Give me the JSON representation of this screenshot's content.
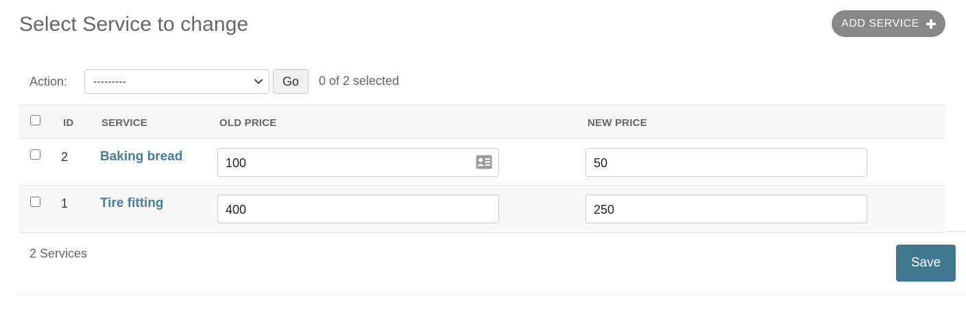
{
  "page": {
    "title": "Select Service to change"
  },
  "header": {
    "add_label": "ADD SERVICE"
  },
  "actions": {
    "label": "Action:",
    "selected_option": "---------",
    "go_label": "Go",
    "selection_text": "0 of 2 selected"
  },
  "table": {
    "columns": [
      "ID",
      "SERVICE",
      "OLD PRICE",
      "NEW PRICE"
    ],
    "rows": [
      {
        "id": "2",
        "service": "Baking bread",
        "old_price": "100",
        "new_price": "50",
        "selected": false
      },
      {
        "id": "1",
        "service": "Tire fitting",
        "old_price": "400",
        "new_price": "250",
        "selected": false
      }
    ]
  },
  "footer": {
    "count_text": "2 Services",
    "save_label": "Save"
  },
  "colors": {
    "link": "#447e9b",
    "save_bg": "#417690",
    "add_bg": "#888888",
    "header_bg": "#f6f6f6"
  },
  "icons": {
    "add": "plus-icon",
    "select": "chevron-down-icon",
    "autofill": "contact-card-icon"
  }
}
